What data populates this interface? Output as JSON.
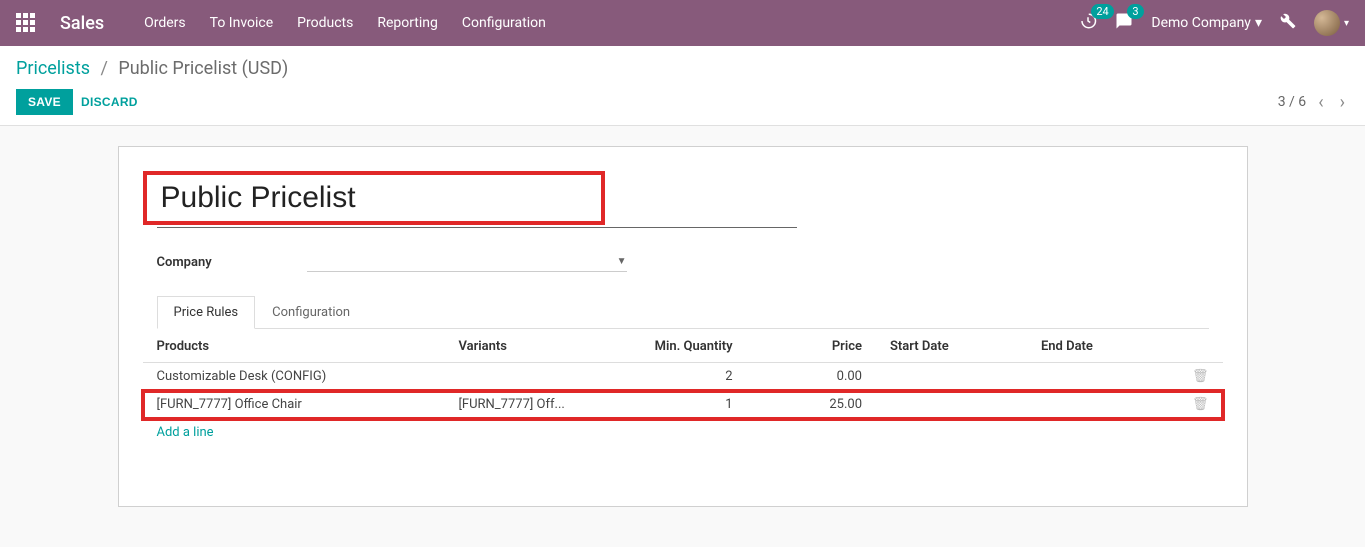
{
  "navbar": {
    "brand": "Sales",
    "menu": [
      "Orders",
      "To Invoice",
      "Products",
      "Reporting",
      "Configuration"
    ],
    "activity_count": "24",
    "message_count": "3",
    "company_label": "Demo Company"
  },
  "breadcrumb": {
    "root": "Pricelists",
    "current": "Public Pricelist (USD)"
  },
  "buttons": {
    "save": "SAVE",
    "discard": "DISCARD"
  },
  "pager": {
    "text": "3 / 6"
  },
  "form": {
    "title": "Public Pricelist",
    "company_label": "Company",
    "company_value": ""
  },
  "tabs": {
    "rules": "Price Rules",
    "config": "Configuration"
  },
  "table": {
    "headers": {
      "products": "Products",
      "variants": "Variants",
      "min_qty": "Min. Quantity",
      "price": "Price",
      "start": "Start Date",
      "end": "End Date"
    },
    "rows": [
      {
        "product": "Customizable Desk (CONFIG)",
        "variant": "",
        "qty": "2",
        "price": "0.00",
        "start": "",
        "end": ""
      },
      {
        "product": "[FURN_7777] Office Chair",
        "variant": "[FURN_7777] Off...",
        "qty": "1",
        "price": "25.00",
        "start": "",
        "end": ""
      }
    ],
    "add_line": "Add a line"
  }
}
